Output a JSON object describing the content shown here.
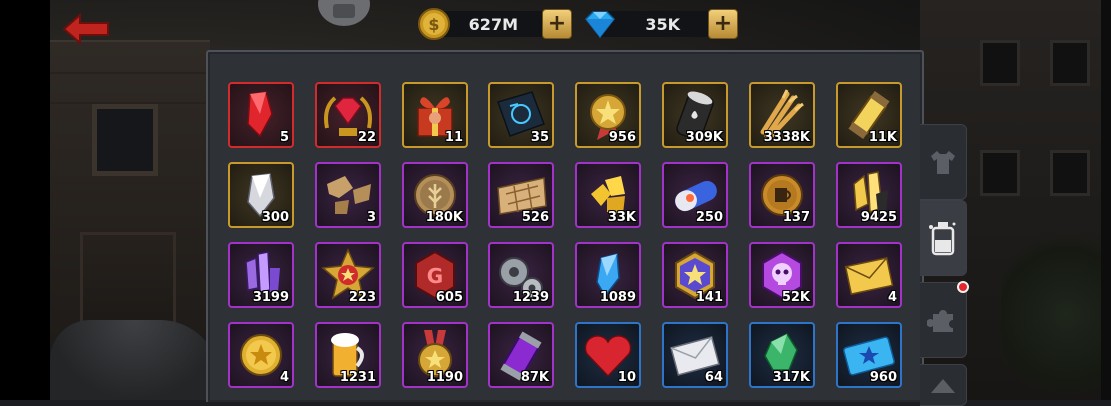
{
  "header": {
    "back_icon": "red-back-arrow-icon",
    "camera_icon": "camera-icon",
    "gold": {
      "icon": "gold-coin-icon",
      "amount": "627M",
      "add_icon": "plus-icon"
    },
    "gems": {
      "icon": "blue-diamond-icon",
      "amount": "35K",
      "add_icon": "plus-icon"
    }
  },
  "inventory": {
    "items": [
      {
        "icon": "red-crystal-icon",
        "qty": "5",
        "rarity": "red"
      },
      {
        "icon": "ruby-laurel-badge-icon",
        "qty": "22",
        "rarity": "red"
      },
      {
        "icon": "gift-box-icon",
        "qty": "11",
        "rarity": "gold"
      },
      {
        "icon": "blueprint-tablet-icon",
        "qty": "35",
        "rarity": "gold"
      },
      {
        "icon": "star-medal-icon",
        "qty": "956",
        "rarity": "gold"
      },
      {
        "icon": "oil-barrel-icon",
        "qty": "309K",
        "rarity": "gold"
      },
      {
        "icon": "wheat-bundle-icon",
        "qty": "3338K",
        "rarity": "gold"
      },
      {
        "icon": "energy-capsule-icon",
        "qty": "11K",
        "rarity": "gold"
      },
      {
        "icon": "silver-crystal-icon",
        "qty": "300",
        "rarity": "gold"
      },
      {
        "icon": "map-fragment-icon",
        "qty": "3",
        "rarity": "purple"
      },
      {
        "icon": "wheat-coin-icon",
        "qty": "180K",
        "rarity": "purple"
      },
      {
        "icon": "treasure-map-icon",
        "qty": "526",
        "rarity": "purple"
      },
      {
        "icon": "gold-nuggets-icon",
        "qty": "33K",
        "rarity": "purple"
      },
      {
        "icon": "pill-capsule-icon",
        "qty": "250",
        "rarity": "purple"
      },
      {
        "icon": "mug-coin-icon",
        "qty": "137",
        "rarity": "purple"
      },
      {
        "icon": "gold-crystals-icon",
        "qty": "9425",
        "rarity": "purple"
      },
      {
        "icon": "purple-crystals-icon",
        "qty": "3199",
        "rarity": "purple"
      },
      {
        "icon": "red-star-badge-icon",
        "qty": "223",
        "rarity": "purple"
      },
      {
        "icon": "g-hexagon-token-icon",
        "qty": "605",
        "rarity": "purple"
      },
      {
        "icon": "gears-icon",
        "qty": "1239",
        "rarity": "purple"
      },
      {
        "icon": "blue-crystal-icon",
        "qty": "1089",
        "rarity": "purple"
      },
      {
        "icon": "star-hexagon-badge-icon",
        "qty": "141",
        "rarity": "purple"
      },
      {
        "icon": "purple-skull-token-icon",
        "qty": "52K",
        "rarity": "purple"
      },
      {
        "icon": "gold-envelope-icon",
        "qty": "4",
        "rarity": "purple"
      },
      {
        "icon": "gold-star-coin-icon",
        "qty": "4",
        "rarity": "purple"
      },
      {
        "icon": "beer-mug-icon",
        "qty": "1231",
        "rarity": "purple"
      },
      {
        "icon": "medal-ribbon-icon",
        "qty": "1190",
        "rarity": "purple"
      },
      {
        "icon": "purple-canister-icon",
        "qty": "87K",
        "rarity": "purple"
      },
      {
        "icon": "red-heart-icon",
        "qty": "10",
        "rarity": "blue"
      },
      {
        "icon": "white-envelope-icon",
        "qty": "64",
        "rarity": "blue"
      },
      {
        "icon": "green-crystal-icon",
        "qty": "317K",
        "rarity": "blue"
      },
      {
        "icon": "blue-star-ticket-icon",
        "qty": "960",
        "rarity": "blue"
      }
    ]
  },
  "side_tabs": [
    {
      "icon": "shirt-icon",
      "active": false
    },
    {
      "icon": "potion-bottle-icon",
      "active": true
    },
    {
      "icon": "puzzle-piece-icon",
      "active": false,
      "notification": true
    },
    {
      "icon": "hat-icon",
      "active": false
    }
  ],
  "colors": {
    "rarity_red": "#d12b2b",
    "rarity_gold": "#c79a2b",
    "rarity_purple": "#a332c9",
    "rarity_blue": "#2e75c9",
    "notification": "#e5252b"
  }
}
